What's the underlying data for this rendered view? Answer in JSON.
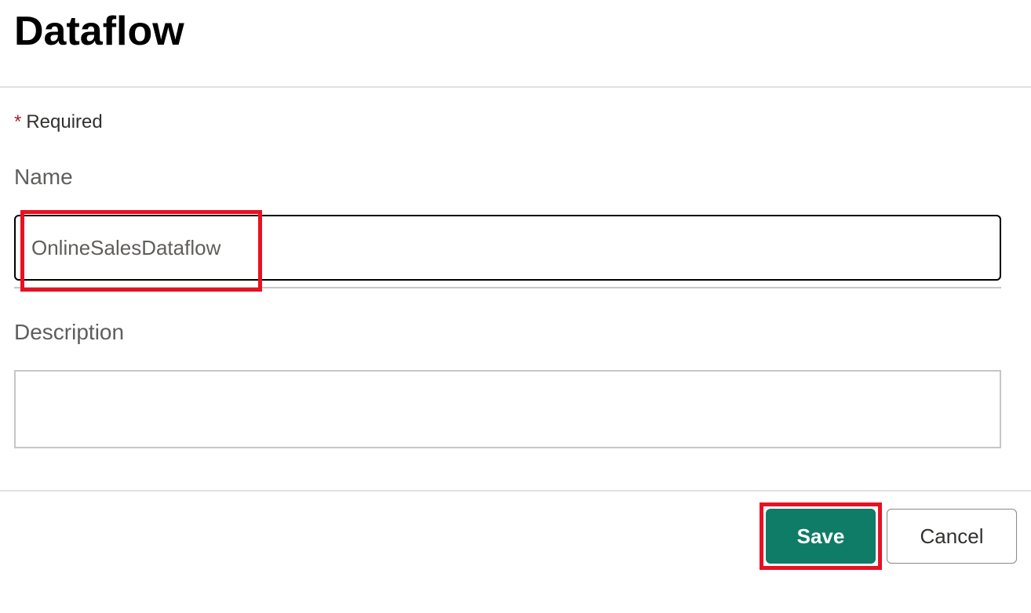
{
  "dialog": {
    "title": "Dataflow",
    "required_note": "Required",
    "name_label": "Name",
    "name_value": "OnlineSalesDataflow",
    "description_label": "Description",
    "description_value": "",
    "save_label": "Save",
    "cancel_label": "Cancel"
  },
  "colors": {
    "highlight": "#e81123",
    "primary_button": "#0e7c66"
  }
}
